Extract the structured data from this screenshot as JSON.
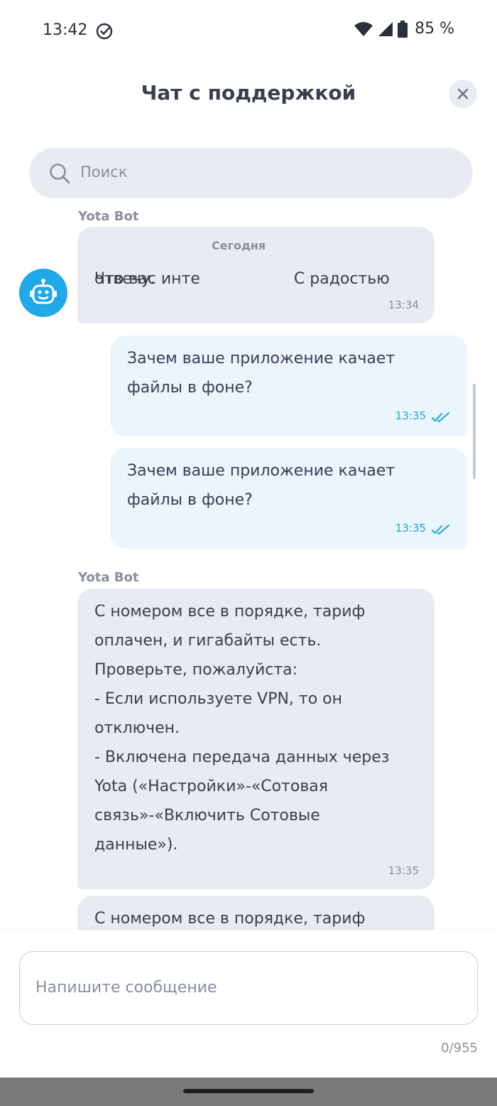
{
  "status_bar": {
    "time": "13:42",
    "battery": "85 %"
  },
  "header": {
    "title": "Чат с поддержкой"
  },
  "search": {
    "placeholder": "Поиск"
  },
  "chat": {
    "date_chip": "Сегодня",
    "messages": [
      {
        "sender": "Yota Bot",
        "text_before": "Что вас инте",
        "text_after": "С радостью",
        "text_line2": "отвечу.",
        "time": "13:34"
      },
      {
        "text": "Зачем ваше приложение качает\nфайлы в фоне?",
        "time": "13:35"
      },
      {
        "text": "Зачем ваше приложение качает\nфайлы в фоне?",
        "time": "13:35"
      },
      {
        "sender": "Yota Bot",
        "text": "С номером все в порядке, тариф\nоплачен, и гигабайты есть.\nПроверьте, пожалуйста:\n- Если используете VPN, то он\nотключен.\n- Включена передача данных через\nYota («Настройки»-«Сотовая\nсвязь»-«Включить Сотовые\nданные»).",
        "time": "13:35"
      },
      {
        "text": "С номером все в порядке, тариф"
      }
    ]
  },
  "composer": {
    "placeholder": "Напишите сообщение",
    "counter": "0/955"
  },
  "colors": {
    "accent": "#1ba7d8",
    "bot_bubble": "#e9ebf2",
    "user_bubble": "#eaf5fd",
    "avatar": "#1fa9e8"
  },
  "icons": [
    "check-circle-icon",
    "wifi-icon",
    "signal-icon",
    "battery-icon",
    "close-icon",
    "search-icon",
    "robot-icon",
    "double-check-icon"
  ]
}
